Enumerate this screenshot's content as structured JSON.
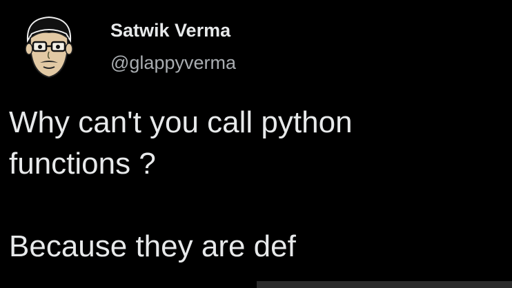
{
  "tweet": {
    "author": {
      "display_name": "Satwik Verma",
      "handle": "@glappyverma",
      "avatar_icon": "cartoon-face-avatar"
    },
    "body": {
      "line1": "Why can't you call python",
      "line2": "functions ?",
      "punchline": "Because they are def"
    }
  },
  "colors": {
    "background": "#000000",
    "primary_text": "#e7e9ea",
    "secondary_text": "#a9adb1"
  }
}
